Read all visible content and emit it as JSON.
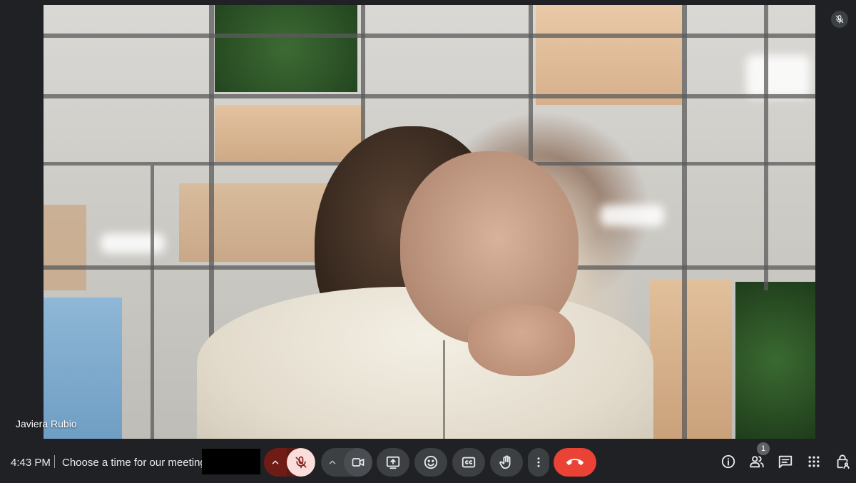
{
  "participant": {
    "name": "Javiera Rubio"
  },
  "bar": {
    "time": "4:43 PM",
    "meeting_title": "Choose a time for our meeting:",
    "participant_count": "1"
  },
  "colors": {
    "background": "#202124",
    "button": "#3c4043",
    "end_call": "#ea4335",
    "mic_off_bg": "#f9dedc",
    "mic_off_icon": "#8c1d18"
  },
  "icons": {
    "participant_mic": "mic-off-icon",
    "mic_options": "chevron-up-icon",
    "mic": "mic-off-icon",
    "camera_options": "chevron-up-icon",
    "camera": "videocam-icon",
    "present": "present-screen-icon",
    "reactions": "emoji-icon",
    "captions": "closed-caption-icon",
    "raise_hand": "hand-icon",
    "more": "more-vertical-icon",
    "end_call": "call-end-icon",
    "info": "info-icon",
    "people": "people-icon",
    "chat": "chat-icon",
    "activities": "apps-grid-icon",
    "host_controls": "lock-person-icon"
  }
}
